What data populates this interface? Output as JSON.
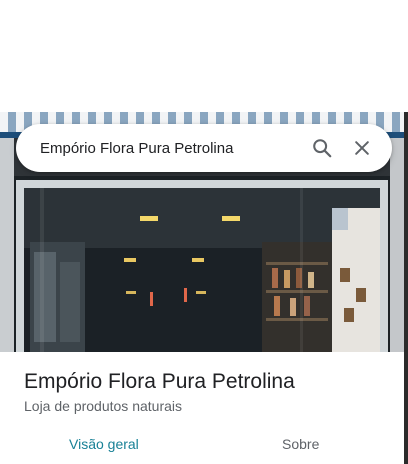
{
  "search": {
    "value": "Empório Flora Pura Petrolina",
    "search_icon": "search-icon",
    "close_icon": "close-icon"
  },
  "place": {
    "name": "Empório Flora Pura Petrolina",
    "category": "Loja de produtos naturais"
  },
  "tabs": [
    {
      "label": "Visão geral",
      "active": true
    },
    {
      "label": "Sobre",
      "active": false
    }
  ],
  "colors": {
    "accent": "#188196",
    "text_primary": "#202124",
    "text_secondary": "#5f6368"
  }
}
